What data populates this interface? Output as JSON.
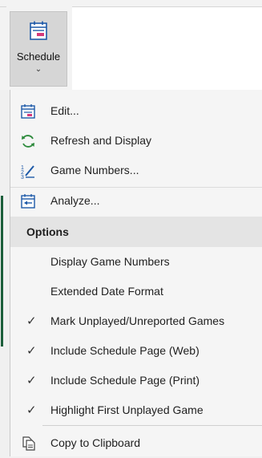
{
  "ribbon": {
    "schedule_label": "Schedule",
    "dropdown_indicator": "⌄",
    "schedule_icon": "schedule-icon"
  },
  "menu": {
    "actions": [
      {
        "label": "Edit...",
        "icon": "schedule-edit-icon"
      },
      {
        "label": "Refresh and Display",
        "icon": "refresh-icon"
      },
      {
        "label": "Game Numbers...",
        "icon": "game-numbers-icon"
      },
      {
        "label": "Analyze...",
        "icon": "analyze-icon"
      }
    ],
    "options_header": "Options",
    "options": [
      {
        "label": "Display Game Numbers",
        "checked": false
      },
      {
        "label": "Extended Date Format",
        "checked": false
      },
      {
        "label": "Mark Unplayed/Unreported Games",
        "checked": true
      },
      {
        "label": "Include Schedule Page (Web)",
        "checked": true
      },
      {
        "label": "Include Schedule Page (Print)",
        "checked": true
      },
      {
        "label": "Highlight First Unplayed Game",
        "checked": true
      }
    ],
    "footer": [
      {
        "label": "Copy to Clipboard",
        "icon": "copy-icon"
      }
    ],
    "check_glyph": "✓"
  },
  "colors": {
    "accent_green": "#1b5e3a",
    "icon_blue": "#1e5aa8",
    "icon_pink": "#d63a7a",
    "refresh_green": "#2e8b3d"
  }
}
